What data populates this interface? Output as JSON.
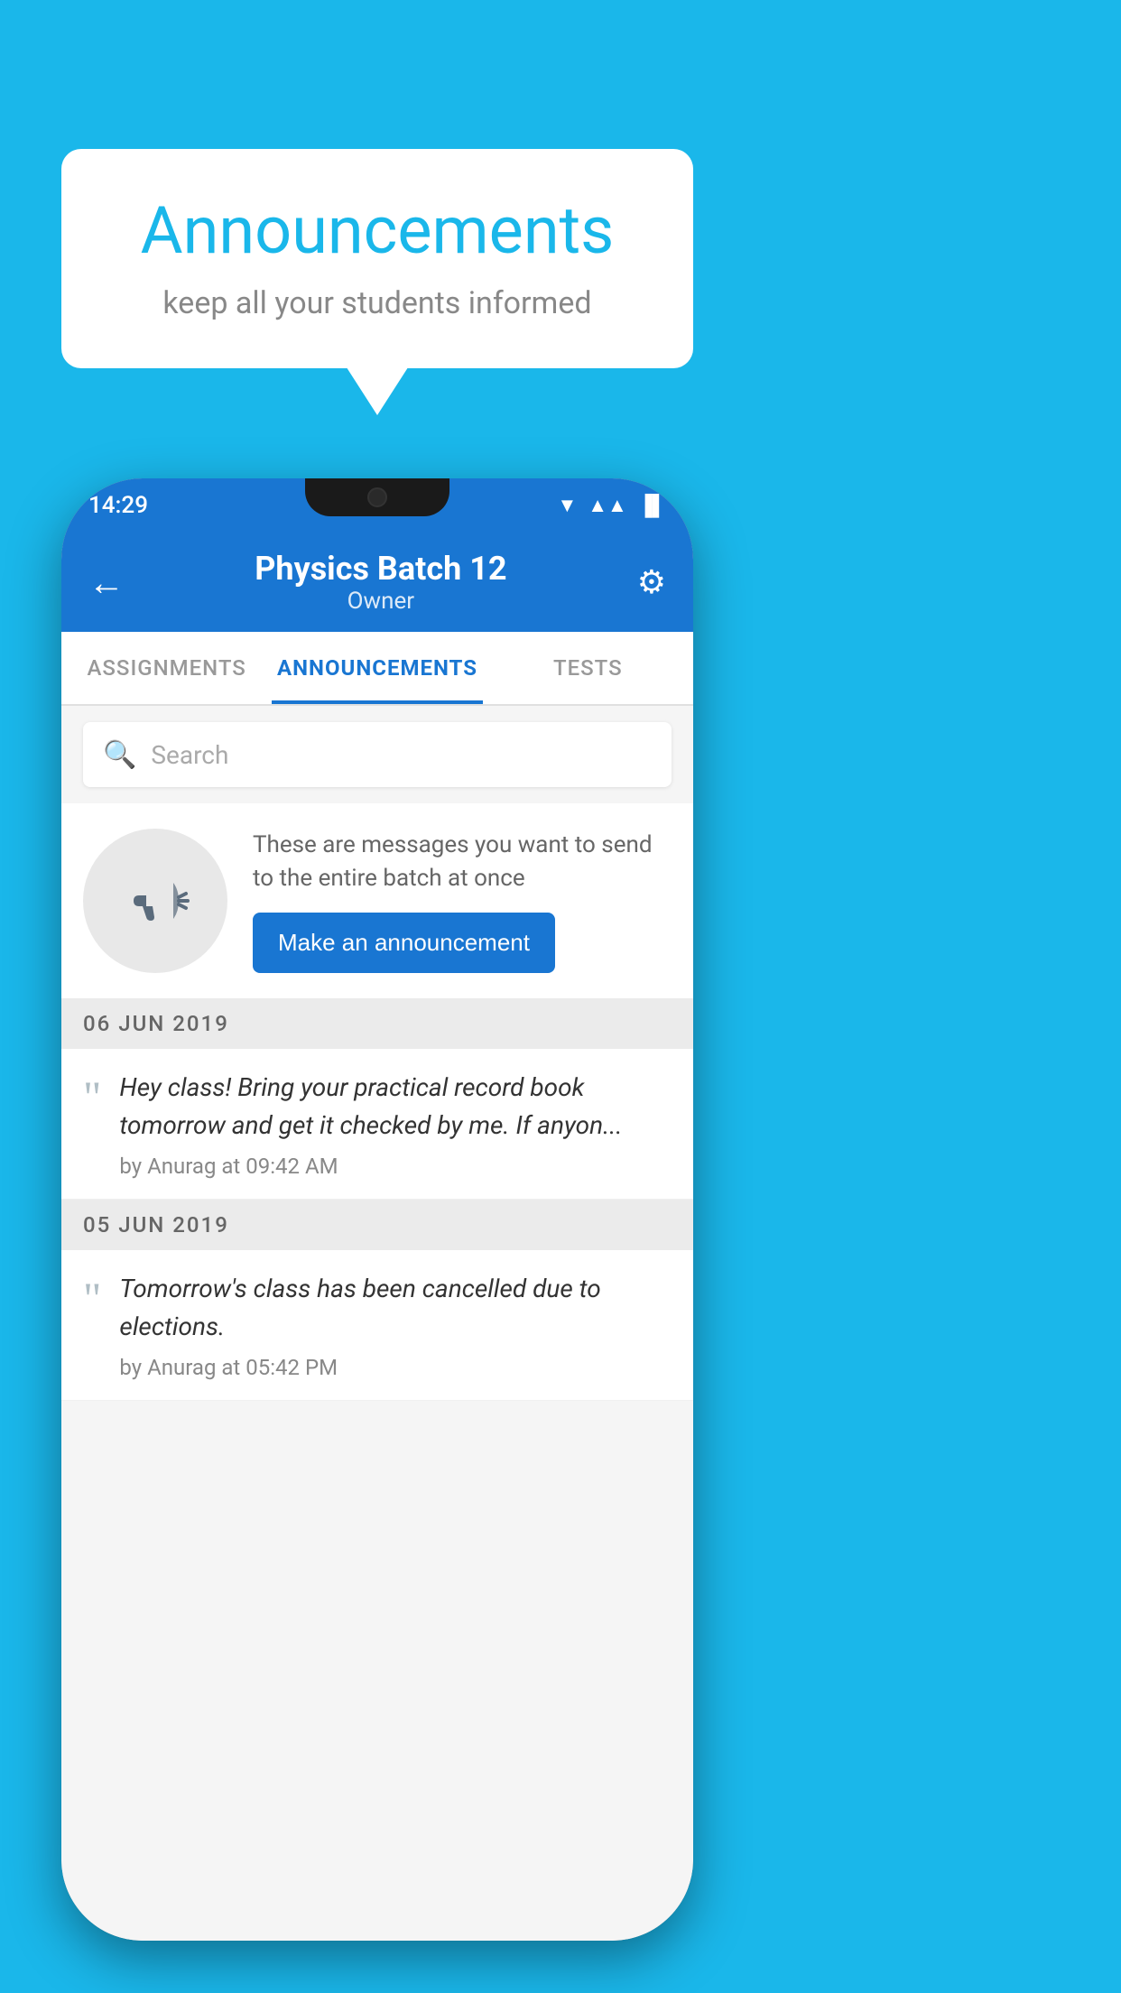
{
  "background_color": "#1ab7ea",
  "speech_bubble": {
    "title": "Announcements",
    "subtitle": "keep all your students informed"
  },
  "phone": {
    "status_bar": {
      "time": "14:29",
      "wifi": "▲",
      "signal": "▲",
      "battery": "▪"
    },
    "app_bar": {
      "back_label": "←",
      "title": "Physics Batch 12",
      "subtitle": "Owner",
      "gear_label": "⚙"
    },
    "tabs": [
      {
        "label": "ASSIGNMENTS",
        "active": false
      },
      {
        "label": "ANNOUNCEMENTS",
        "active": true
      },
      {
        "label": "TESTS",
        "active": false
      }
    ],
    "search": {
      "placeholder": "Search"
    },
    "promo": {
      "description": "These are messages you want to send to the entire batch at once",
      "button_label": "Make an announcement"
    },
    "announcements": [
      {
        "date": "06  JUN  2019",
        "text": "Hey class! Bring your practical record book tomorrow and get it checked by me. If anyon...",
        "meta": "by Anurag at 09:42 AM"
      },
      {
        "date": "05  JUN  2019",
        "text": "Tomorrow's class has been cancelled due to elections.",
        "meta": "by Anurag at 05:42 PM"
      }
    ]
  }
}
